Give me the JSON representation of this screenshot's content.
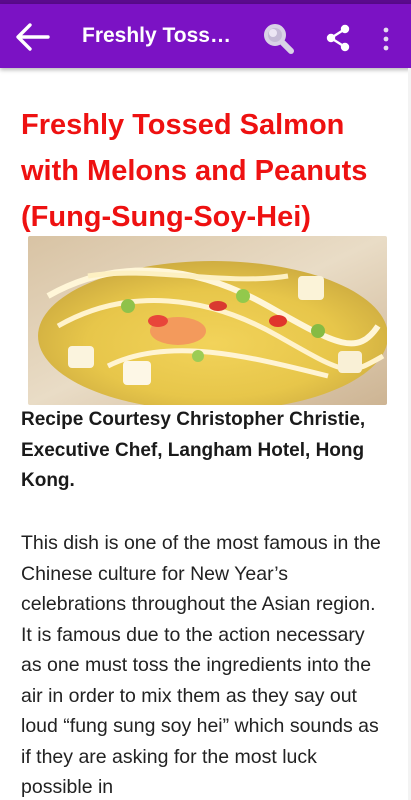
{
  "toolbar": {
    "title": "Freshly Tossed Salmon with Melons and Peanuts (Fung-Sung-Soy-Hei)",
    "icons": [
      "back-arrow-icon",
      "search-icon",
      "share-icon",
      "more-vert-icon"
    ],
    "background_color": "#7b12c4"
  },
  "recipe": {
    "title": "Freshly Tossed Salmon with Melons and Peanuts (Fung-Sung-Soy-Hei)",
    "title_color": "#ee1111",
    "credit": "Recipe Courtesy Christopher Christie, Executive Chef, Langham Hotel, Hong Kong.",
    "intro": "This dish is one of the most famous in the Chinese culture for New Year’s celebrations throughout the Asian region. It is famous due to the action necessary as one must toss the ingredients into the air in order to mix them as they say out loud “fung sung soy hei” which sounds as if they are asking for the most luck possible in"
  }
}
